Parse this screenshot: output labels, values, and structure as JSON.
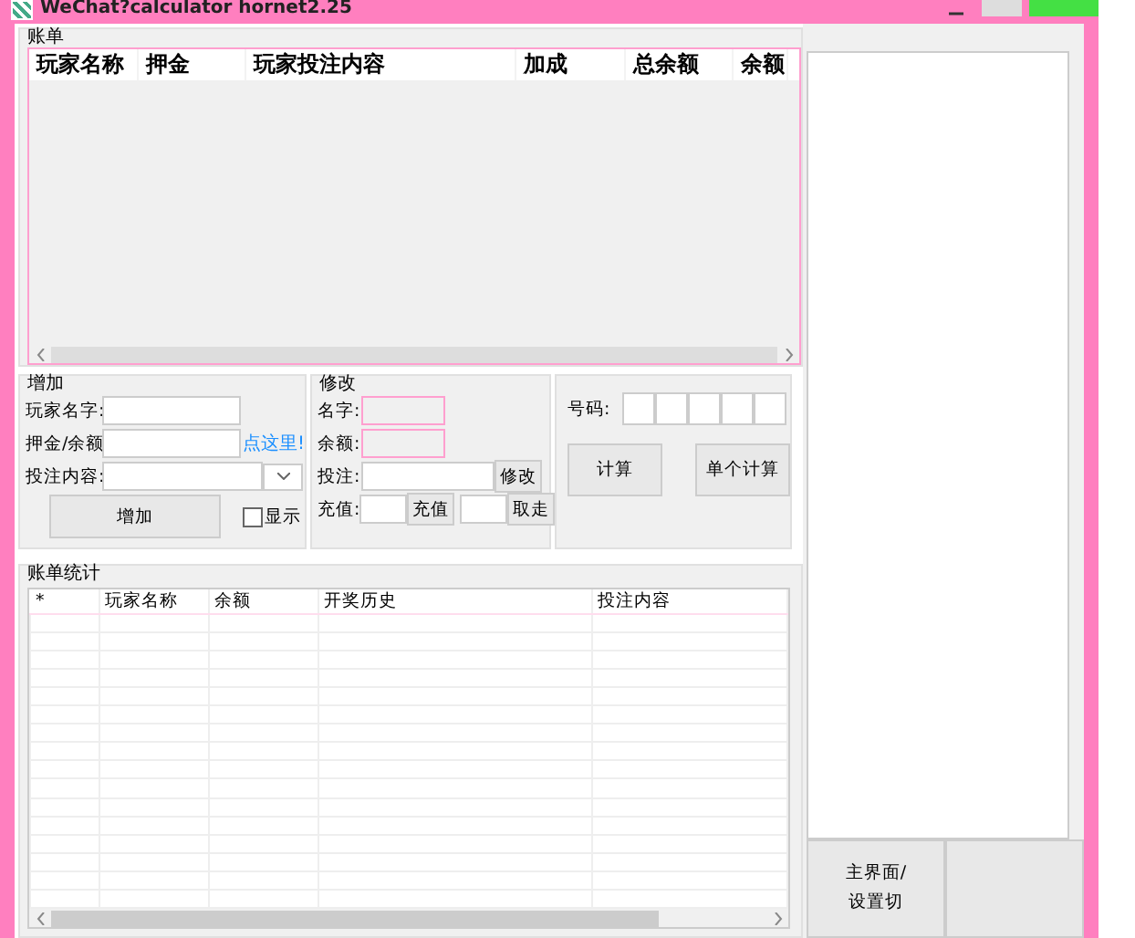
{
  "window": {
    "title": "WeChat?calculator hornet2.25"
  },
  "bill": {
    "title": "账单",
    "columns": [
      "玩家名称",
      "押金",
      "玩家投注内容",
      "加成",
      "总余额",
      "余额"
    ]
  },
  "add": {
    "title": "增加",
    "name_label": "玩家名字:",
    "deposit_label": "押金/余额",
    "link": "点这里!",
    "bet_label": "投注内容:",
    "add_button": "增加",
    "show": {
      "label": "显示",
      "checked": false
    }
  },
  "modify": {
    "title": "修改",
    "name_label": "名字:",
    "balance_label": "余额:",
    "bet_label": "投注:",
    "modify_button": "修改",
    "recharge_label": "充值:",
    "recharge_button": "充值",
    "withdraw_button": "取走"
  },
  "calc": {
    "number_label": "号码:",
    "calc_button": "计算",
    "single_button": "单个计算"
  },
  "stats": {
    "title": "账单统计",
    "columns": [
      "*",
      "玩家名称",
      "余额",
      "开奖历史",
      "投注内容"
    ]
  },
  "side_buttons": [
    {
      "label_lines": [
        "主界面/",
        "设置切"
      ]
    }
  ]
}
